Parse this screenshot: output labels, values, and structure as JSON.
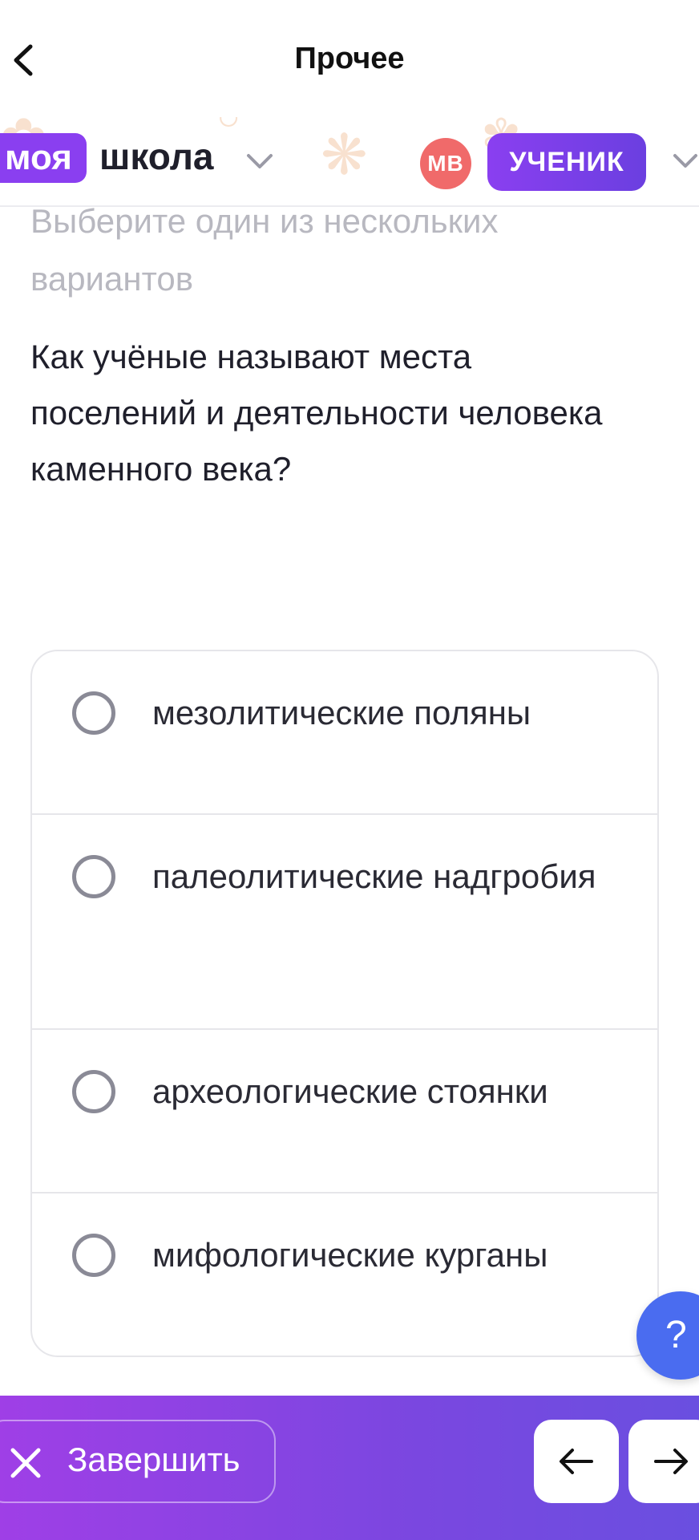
{
  "topbar": {
    "title": "Прочее"
  },
  "brand": {
    "logo_part1": "моя",
    "logo_part2": "школа",
    "avatar_initials": "МВ",
    "role": "УЧЕНИК"
  },
  "quiz": {
    "instruction": "Выберите один из нескольких вариантов",
    "question": "Как учёные называют места поселений и деятельности человека каменного века?",
    "options": [
      {
        "label": "мезолитические поляны",
        "selected": false
      },
      {
        "label": "палеолитические надгробия",
        "selected": false
      },
      {
        "label": "археологические стоянки",
        "selected": false
      },
      {
        "label": "мифологические курганы",
        "selected": false
      }
    ]
  },
  "help": {
    "label": "?"
  },
  "footer": {
    "finish_label": "Завершить"
  },
  "colors": {
    "accent": "#8a3ff0",
    "help_blue": "#4a6cf0",
    "avatar_red": "#f06a6a"
  },
  "icons": {
    "back": "chevron-left-icon",
    "close": "close-icon",
    "prev": "arrow-left-icon",
    "next": "arrow-right-icon"
  }
}
